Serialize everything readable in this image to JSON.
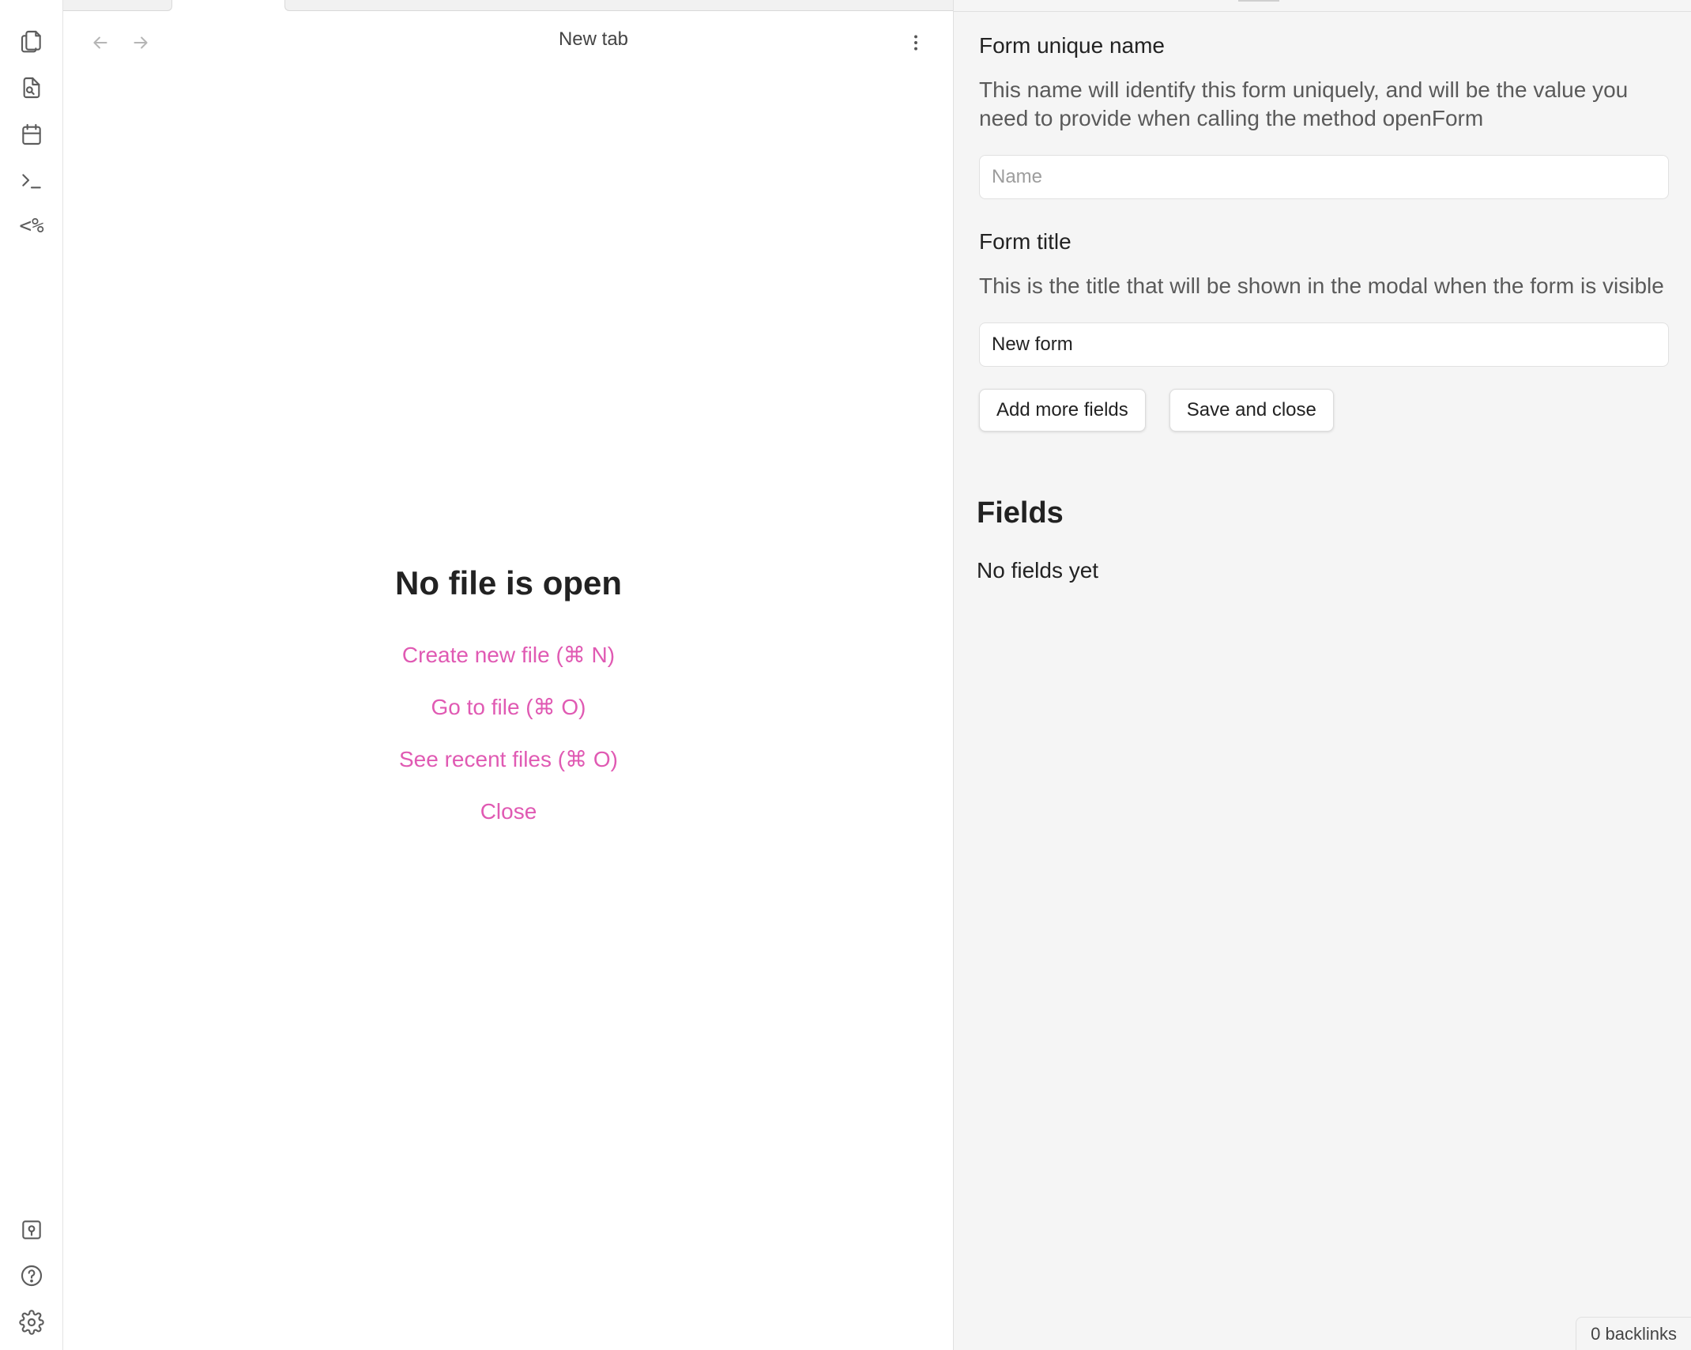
{
  "ribbon": {
    "top_icons": [
      "files-icon",
      "file-search-icon",
      "calendar-icon",
      "terminal-icon",
      "template-icon"
    ],
    "bottom_icons": [
      "vault-icon",
      "help-icon",
      "settings-icon"
    ],
    "template_glyph": "<%"
  },
  "main": {
    "view_title": "New tab",
    "empty_state": {
      "title": "No file is open",
      "actions": [
        "Create new file (⌘ N)",
        "Go to file (⌘ O)",
        "See recent files (⌘ O)",
        "Close"
      ]
    }
  },
  "form": {
    "name": {
      "label": "Form unique name",
      "description": "This name will identify this form uniquely, and will be the value you need to provide when calling the method openForm",
      "placeholder": "Name",
      "value": ""
    },
    "title": {
      "label": "Form title",
      "description": "This is the title that will be shown in the modal when the form is visible",
      "value": "New form"
    },
    "buttons": {
      "add_fields": "Add more fields",
      "save_close": "Save and close"
    },
    "fields_heading": "Fields",
    "fields_empty": "No fields yet"
  },
  "status_bar": {
    "backlinks": "0 backlinks"
  },
  "colors": {
    "accent": "#e05ab3",
    "sidebar_bg": "#f5f5f5",
    "main_bg": "#ffffff"
  }
}
